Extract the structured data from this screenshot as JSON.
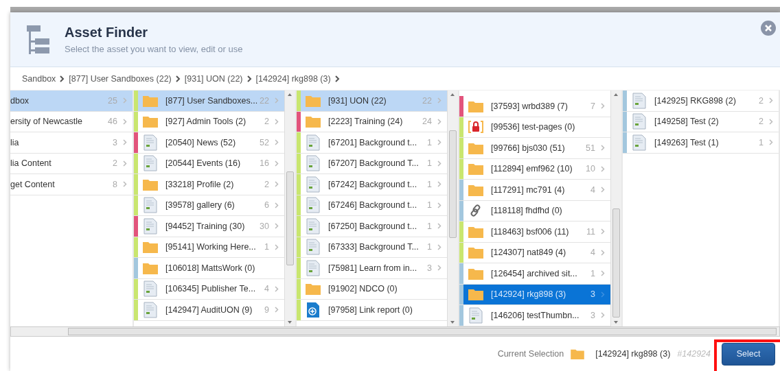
{
  "dialog": {
    "title": "Asset Finder",
    "subtitle": "Select the asset you want to view, edit or use"
  },
  "breadcrumb": [
    "Sandbox",
    "[877] User Sandboxes (22)",
    "[931] UON (22)",
    "[142924] rkg898 (3)"
  ],
  "columns": [
    {
      "items": [
        {
          "label": "dbox",
          "count": "25",
          "selected": true,
          "focused": false
        },
        {
          "label": "ersity of Newcastle",
          "count": "46",
          "selected": false,
          "focused": false
        },
        {
          "label": "lia",
          "count": "3",
          "selected": false,
          "focused": false
        },
        {
          "label": "lia Content",
          "count": "2",
          "selected": false,
          "focused": false
        },
        {
          "label": "get Content",
          "count": "8",
          "selected": false,
          "focused": false
        }
      ]
    },
    {
      "items": [
        {
          "kind": "folder",
          "color": "#c9e66f",
          "label": "[877] User Sandboxes...",
          "count": "22",
          "selected": true,
          "focused": false
        },
        {
          "kind": "folder",
          "color": "#c9e66f",
          "label": "[927] Admin Tools (2)",
          "count": "2",
          "selected": false,
          "focused": false
        },
        {
          "kind": "page",
          "color": "#e2547c",
          "label": "[20540] News (52)",
          "count": "52",
          "selected": false,
          "focused": false
        },
        {
          "kind": "page",
          "color": "#c9e66f",
          "label": "[20544] Events (16)",
          "count": "16",
          "selected": false,
          "focused": false
        },
        {
          "kind": "folder",
          "color": "#c9e66f",
          "label": "[33218] Profile (2)",
          "count": "2",
          "selected": false,
          "focused": false
        },
        {
          "kind": "page",
          "color": "#c9e66f",
          "label": "[39578] gallery (6)",
          "count": "6",
          "selected": false,
          "focused": false
        },
        {
          "kind": "page",
          "color": "#e2547c",
          "label": "[94452] Training (30)",
          "count": "30",
          "selected": false,
          "focused": false
        },
        {
          "kind": "folder",
          "color": "#c9e66f",
          "label": "[95141] Working Here...",
          "count": "1",
          "selected": false,
          "focused": false
        },
        {
          "kind": "folder",
          "color": "#a3c7de",
          "label": "[106018] MattsWork (0)",
          "selected": false,
          "focused": false
        },
        {
          "kind": "page",
          "color": "#c9e66f",
          "label": "[106345] Publisher Te...",
          "count": "4",
          "selected": false,
          "focused": false
        },
        {
          "kind": "page",
          "color": "#c9e66f",
          "label": "[142947] AuditUON (9)",
          "count": "9",
          "selected": false,
          "focused": false
        }
      ]
    },
    {
      "items": [
        {
          "kind": "folder",
          "color": "#c9e66f",
          "label": "[931] UON (22)",
          "count": "22",
          "selected": true,
          "focused": false
        },
        {
          "kind": "folder",
          "color": "#e2547c",
          "label": "[2223] Training (24)",
          "count": "24",
          "selected": false,
          "focused": false
        },
        {
          "kind": "page",
          "color": "#c9e66f",
          "label": "[67201] Background t...",
          "count": "1",
          "selected": false,
          "focused": false
        },
        {
          "kind": "page",
          "color": "#c9e66f",
          "label": "[67207] Background T...",
          "count": "1",
          "selected": false,
          "focused": false
        },
        {
          "kind": "page",
          "color": "#c9e66f",
          "label": "[67242] Background t...",
          "count": "1",
          "selected": false,
          "focused": false
        },
        {
          "kind": "page",
          "color": "#c9e66f",
          "label": "[67246] Background t...",
          "count": "1",
          "selected": false,
          "focused": false
        },
        {
          "kind": "page",
          "color": "#c9e66f",
          "label": "[67250] Background t...",
          "count": "1",
          "selected": false,
          "focused": false
        },
        {
          "kind": "page",
          "color": "#c9e66f",
          "label": "[67333] Background T...",
          "count": "1",
          "selected": false,
          "focused": false
        },
        {
          "kind": "page",
          "color": "#c9e66f",
          "label": "[75981] Learn from in...",
          "count": "3",
          "selected": false,
          "focused": false
        },
        {
          "kind": "folder",
          "color": "#c9e66f",
          "label": "[91902] NDCO (0)",
          "selected": false,
          "focused": false
        },
        {
          "kind": "report",
          "color": "#c9e66f",
          "label": "[97958] Link report (0)",
          "selected": false,
          "focused": false
        }
      ]
    },
    {
      "items": [
        {
          "kind": "folder",
          "color": "#e2547c",
          "label": "[37593] wrbd389 (7)",
          "count": "7",
          "selected": false,
          "focused": false
        },
        {
          "kind": "locked",
          "color": "#c9e66f",
          "label": "[99536] test-pages (0)",
          "selected": false,
          "focused": false
        },
        {
          "kind": "folder",
          "color": "#c9e66f",
          "label": "[99766] bjs030 (51)",
          "count": "51",
          "selected": false,
          "focused": false
        },
        {
          "kind": "folder",
          "color": "#c9e66f",
          "label": "[112894] emf962 (10)",
          "count": "10",
          "selected": false,
          "focused": false
        },
        {
          "kind": "folder",
          "color": "#a3c7de",
          "label": "[117291] mc791 (4)",
          "count": "4",
          "selected": false,
          "focused": false
        },
        {
          "kind": "link",
          "color": "#a3c7de",
          "label": "[118118] fhdfhd (0)",
          "selected": false,
          "focused": false
        },
        {
          "kind": "folder",
          "color": "#c9e66f",
          "label": "[118463] bsf006 (11)",
          "count": "11",
          "selected": false,
          "focused": false
        },
        {
          "kind": "folder",
          "color": "#c9e66f",
          "label": "[124307] nat849 (4)",
          "count": "4",
          "selected": false,
          "focused": false
        },
        {
          "kind": "folder",
          "color": "#a3c7de",
          "label": "[126454] archived sit...",
          "count": "1",
          "selected": false,
          "focused": false
        },
        {
          "kind": "folder",
          "color": "#a3c7de",
          "label": "[142924] rkg898 (3)",
          "count": "3",
          "selected": true,
          "focused": true
        },
        {
          "kind": "page",
          "color": "#a3c7de",
          "label": "[146206] testThumbn...",
          "count": "3",
          "selected": false,
          "focused": false
        }
      ]
    },
    {
      "items": [
        {
          "kind": "page",
          "color": "#a3c7de",
          "label": "[142925] RKG898 (2)",
          "count": "2",
          "selected": false,
          "focused": false
        },
        {
          "kind": "page",
          "color": "#a3c7de",
          "label": "[149258] Test (2)",
          "count": "2",
          "selected": false,
          "focused": false
        },
        {
          "kind": "page",
          "color": "#a3c7de",
          "label": "[149263] Test (1)",
          "count": "1",
          "selected": false,
          "focused": false
        }
      ]
    }
  ],
  "footer": {
    "label": "Current Selection",
    "selection": "[142924] rkg898 (3)",
    "asset_id": "#142924",
    "button": "Select"
  }
}
